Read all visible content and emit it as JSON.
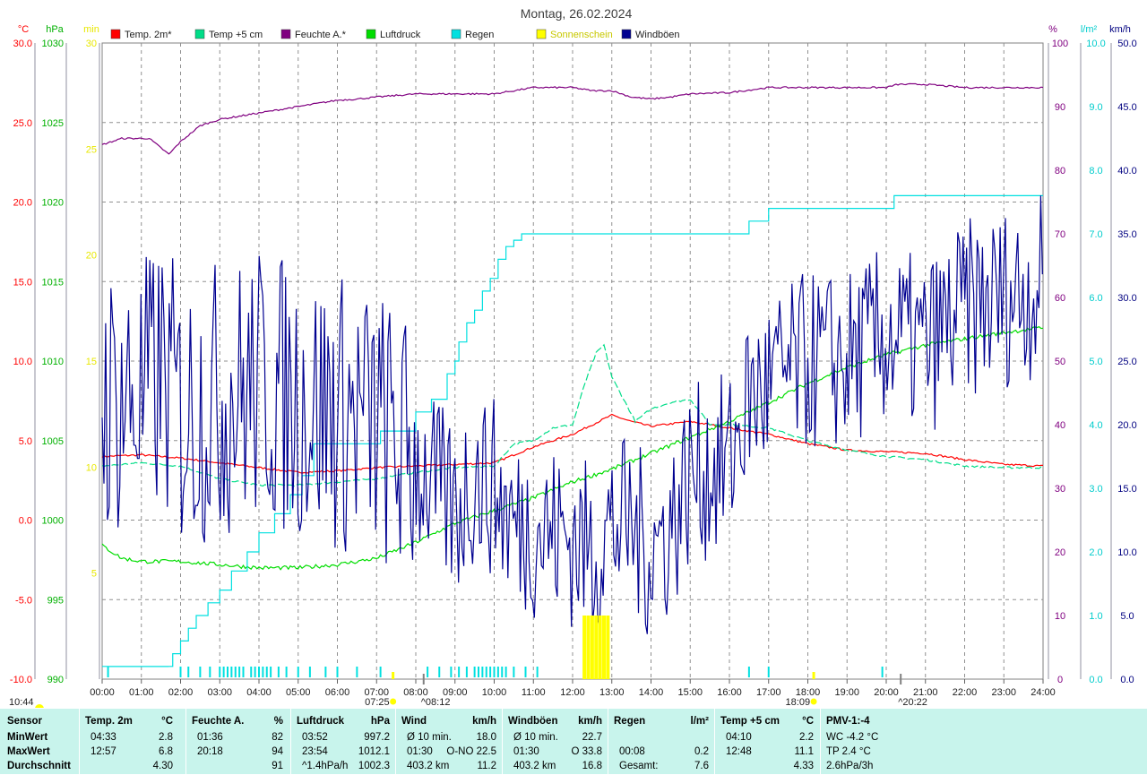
{
  "chart_data": {
    "type": "line",
    "title": "Montag, 26.02.2024",
    "x_tick_labels": [
      "00:00",
      "01:00",
      "02:00",
      "03:00",
      "04:00",
      "05:00",
      "06:00",
      "07:00",
      "08:00",
      "09:00",
      "10:00",
      "11:00",
      "12:00",
      "13:00",
      "14:00",
      "15:00",
      "16:00",
      "17:00",
      "18:00",
      "19:00",
      "20:00",
      "21:00",
      "22:00",
      "23:00",
      "24:00"
    ],
    "xlim": [
      0,
      24
    ],
    "axes": {
      "temp": {
        "unit": "°C",
        "color": "#ff0000",
        "ylim": [
          -10,
          30
        ],
        "ticks": [
          "30.0",
          "25.0",
          "20.0",
          "15.0",
          "10.0",
          "5.0",
          "0.0",
          "-5.0",
          "-10.0"
        ]
      },
      "pressure": {
        "unit": "hPa",
        "color": "#00b000",
        "ylim": [
          990,
          1030
        ],
        "ticks": [
          "1030",
          "1025",
          "1020",
          "1015",
          "1010",
          "1005",
          "1000",
          "995",
          "990"
        ]
      },
      "sunshine": {
        "unit": "min",
        "color": "#e8e800",
        "ylim": [
          0,
          30
        ],
        "ticks": [
          "30",
          "25",
          "20",
          "15",
          "10",
          "5"
        ]
      },
      "humidity": {
        "unit": "%",
        "color": "#800080",
        "ylim": [
          0,
          100
        ],
        "ticks": [
          "100",
          "90",
          "80",
          "70",
          "60",
          "50",
          "40",
          "30",
          "20",
          "10",
          "0"
        ]
      },
      "rain": {
        "unit": "l/m²",
        "color": "#00cccc",
        "ylim": [
          0,
          10
        ],
        "ticks": [
          "10.0",
          "9.0",
          "8.0",
          "7.0",
          "6.0",
          "5.0",
          "4.0",
          "3.0",
          "2.0",
          "1.0",
          "0.0"
        ]
      },
      "wind": {
        "unit": "km/h",
        "color": "#000080",
        "ylim": [
          0,
          50
        ],
        "ticks": [
          "50.0",
          "45.0",
          "40.0",
          "35.0",
          "30.0",
          "25.0",
          "20.0",
          "15.0",
          "10.0",
          "5.0",
          "0.0"
        ]
      }
    },
    "legend": [
      {
        "name": "Temp. 2m*",
        "color": "#ff0000"
      },
      {
        "name": "Temp +5 cm",
        "color": "#00dd88"
      },
      {
        "name": "Feuchte A.*",
        "color": "#800080"
      },
      {
        "name": "Luftdruck",
        "color": "#00dd00"
      },
      {
        "name": "Regen",
        "color": "#00e0e0"
      },
      {
        "name": "Sonnenschein",
        "color": "#ffff00"
      },
      {
        "name": "Windböen",
        "color": "#000090"
      }
    ],
    "series": [
      {
        "name": "Temp. 2m*",
        "axis": "temp",
        "x": [
          0,
          1,
          2,
          3,
          4,
          5,
          6,
          7,
          8,
          9,
          10,
          11,
          12,
          12.5,
          13,
          13.5,
          14,
          15,
          16,
          17,
          18,
          19,
          20,
          21,
          22,
          23,
          24
        ],
        "y": [
          4.0,
          4.1,
          3.9,
          3.6,
          3.3,
          3.0,
          3.1,
          3.3,
          3.4,
          3.5,
          3.6,
          4.6,
          5.4,
          6.0,
          6.6,
          6.2,
          5.9,
          6.2,
          5.8,
          5.4,
          4.8,
          4.4,
          4.3,
          4.2,
          3.8,
          3.5,
          3.4
        ]
      },
      {
        "name": "Temp +5 cm",
        "axis": "temp",
        "x": [
          0,
          1,
          2,
          3,
          4,
          5,
          6,
          7,
          8,
          9,
          10,
          10.5,
          11,
          11.5,
          12,
          12.3,
          12.6,
          12.8,
          13,
          13.3,
          13.6,
          14,
          14.5,
          15,
          15.5,
          16,
          17,
          18,
          19,
          20,
          21,
          22,
          23,
          24
        ],
        "y": [
          3.4,
          3.6,
          3.4,
          2.6,
          2.2,
          2.2,
          2.4,
          2.6,
          3.0,
          3.3,
          3.4,
          4.8,
          5.0,
          5.8,
          6.0,
          8.5,
          10.5,
          11.0,
          9.0,
          7.6,
          6.2,
          7.0,
          7.4,
          7.6,
          6.0,
          6.0,
          5.8,
          5.0,
          4.4,
          4.0,
          3.8,
          3.4,
          3.3,
          3.3
        ]
      },
      {
        "name": "Feuchte A.*",
        "axis": "humidity",
        "x": [
          0,
          0.5,
          1,
          1.2,
          1.5,
          1.7,
          2,
          2.5,
          3,
          3.5,
          4,
          4.5,
          5,
          5.5,
          6,
          6.5,
          7,
          8,
          9,
          10,
          11,
          12,
          12.5,
          13,
          13.5,
          14,
          14.5,
          15,
          16,
          17,
          18,
          19,
          20,
          20.3,
          21,
          22,
          23,
          24
        ],
        "y": [
          84,
          85,
          85,
          85,
          83.5,
          82.5,
          84.5,
          87,
          88,
          88.5,
          89,
          89.5,
          90,
          90.5,
          91,
          91.2,
          91.5,
          92,
          92,
          92,
          93,
          93,
          92.5,
          92.5,
          91.5,
          91.2,
          91.5,
          92,
          92.2,
          93,
          93,
          93,
          93,
          93.5,
          93.5,
          93,
          93,
          93
        ]
      },
      {
        "name": "Luftdruck",
        "axis": "pressure",
        "x": [
          0,
          0.5,
          1,
          2,
          3,
          4,
          5,
          6,
          7,
          8,
          9,
          10,
          11,
          12,
          13,
          14,
          15,
          16,
          17,
          18,
          19,
          20,
          21,
          22,
          23,
          24
        ],
        "y": [
          998.4,
          997.6,
          997.4,
          997.4,
          997.2,
          997.0,
          997.0,
          997.2,
          997.6,
          998.6,
          999.8,
          1000.6,
          1001.4,
          1002.4,
          1003.2,
          1004.2,
          1005.2,
          1006.2,
          1007.4,
          1008.6,
          1009.6,
          1010.4,
          1011.0,
          1011.4,
          1011.8,
          1012.1
        ]
      },
      {
        "name": "Regen",
        "axis": "rain",
        "step": true,
        "x": [
          0,
          1.7,
          1.8,
          2.0,
          2.2,
          2.4,
          2.7,
          3.0,
          3.3,
          3.7,
          4.0,
          4.4,
          4.8,
          5.1,
          5.4,
          6.2,
          7.1,
          8.0,
          8.4,
          8.8,
          9.0,
          9.1,
          9.3,
          9.5,
          9.7,
          9.9,
          10.1,
          10.3,
          10.5,
          10.7,
          10.9,
          11.1,
          11.2,
          12.0,
          16.0,
          16.5,
          17.0,
          17.5,
          18.0,
          19.0,
          20.0,
          20.2,
          24
        ],
        "y": [
          0.2,
          0.2,
          0.4,
          0.6,
          0.8,
          1.0,
          1.2,
          1.4,
          1.7,
          2.0,
          2.3,
          2.6,
          2.9,
          3.2,
          3.7,
          3.7,
          3.9,
          4.2,
          4.4,
          4.8,
          5.0,
          5.3,
          5.6,
          5.8,
          6.1,
          6.3,
          6.6,
          6.8,
          6.9,
          7.0,
          7.0,
          7.0,
          7.0,
          7.0,
          7.0,
          7.2,
          7.4,
          7.4,
          7.4,
          7.4,
          7.4,
          7.6,
          7.6
        ]
      },
      {
        "name": "Windböen",
        "axis": "wind",
        "style": "gusty",
        "x": [
          0,
          1,
          1.5,
          2,
          3,
          4,
          5,
          6,
          7,
          8,
          9,
          9.5,
          10,
          10.5,
          11,
          12,
          12.5,
          13,
          13.5,
          14,
          14.5,
          15,
          16,
          16.5,
          17,
          18,
          19,
          20,
          21,
          22,
          23,
          24
        ],
        "y": [
          22,
          22,
          24,
          21,
          22,
          23,
          22,
          21,
          20,
          17,
          13,
          16,
          15,
          12,
          12,
          11,
          10,
          12,
          12,
          10,
          12,
          16,
          17,
          22,
          23,
          25,
          25,
          27,
          26,
          29,
          30,
          31
        ]
      },
      {
        "name": "Sonnenschein",
        "axis": "sunshine",
        "type": "bar",
        "x": [
          12.3,
          12.4,
          12.5,
          12.6,
          12.7,
          12.8,
          12.9
        ],
        "y": [
          3,
          3,
          3,
          3,
          3,
          3,
          3
        ]
      }
    ],
    "rain_ticks_hours": [
      0.15,
      2.0,
      2.2,
      2.5,
      2.75,
      3.0,
      3.1,
      3.2,
      3.3,
      3.4,
      3.5,
      3.6,
      3.8,
      3.9,
      4.0,
      4.1,
      4.2,
      4.3,
      4.5,
      4.7,
      5.0,
      5.3,
      5.7,
      6.0,
      6.5,
      7.1,
      8.3,
      8.6,
      8.9,
      9.1,
      9.3,
      9.5,
      9.6,
      9.7,
      9.8,
      9.9,
      10.0,
      10.1,
      10.2,
      10.3,
      10.5,
      10.8,
      11.1,
      16.5,
      17.0,
      19.9
    ],
    "sunrise": "07:25",
    "sunset": "18:09",
    "markers": [
      {
        "label": "^08:12",
        "hour": 8.2
      },
      {
        "label": "10:44",
        "hour": 10.73
      },
      {
        "label": "^20:22",
        "hour": 20.37
      }
    ]
  },
  "stats": {
    "sensor": {
      "title": "Sensor",
      "rows": [
        "MinWert",
        "MaxWert",
        "Durchschnitt"
      ]
    },
    "temp2m": {
      "title": "Temp. 2m",
      "unit": "°C",
      "rows": [
        [
          "04:33",
          "2.8"
        ],
        [
          "12:57",
          "6.8"
        ],
        [
          "",
          "4.30"
        ]
      ]
    },
    "humidity": {
      "title": "Feuchte A.",
      "unit": "%",
      "rows": [
        [
          "01:36",
          "82"
        ],
        [
          "20:18",
          "94"
        ],
        [
          "",
          "91"
        ]
      ]
    },
    "pressure": {
      "title": "Luftdruck",
      "unit": "hPa",
      "rows": [
        [
          "03:52",
          "997.2"
        ],
        [
          "23:54",
          "1012.1"
        ],
        [
          "^1.4hPa/h",
          "1002.3"
        ]
      ]
    },
    "wind": {
      "title": "Wind",
      "unit": "km/h",
      "rows": [
        [
          "Ø 10 min.",
          "18.0"
        ],
        [
          "01:30",
          "O-NO 22.5"
        ],
        [
          "403.2 km",
          "11.2"
        ]
      ]
    },
    "gusts": {
      "title": "Windböen",
      "unit": "km/h",
      "rows": [
        [
          "Ø 10 min.",
          "22.7"
        ],
        [
          "01:30",
          "O 33.8"
        ],
        [
          "403.2 km",
          "16.8"
        ]
      ]
    },
    "rain": {
      "title": "Regen",
      "unit": "l/m²",
      "rows": [
        [
          "",
          ""
        ],
        [
          "00:08",
          "0.2"
        ],
        [
          "Gesamt:",
          "7.6"
        ]
      ]
    },
    "temp5cm": {
      "title": "Temp +5 cm",
      "unit": "°C",
      "rows": [
        [
          "04:10",
          "2.2"
        ],
        [
          "12:48",
          "11.1"
        ],
        [
          "",
          "4.33"
        ]
      ]
    },
    "pmv": {
      "title": "PMV-1:-4",
      "rows": [
        "WC -4.2 °C",
        "TP 2.4 °C",
        "2.6hPa/3h"
      ]
    }
  }
}
